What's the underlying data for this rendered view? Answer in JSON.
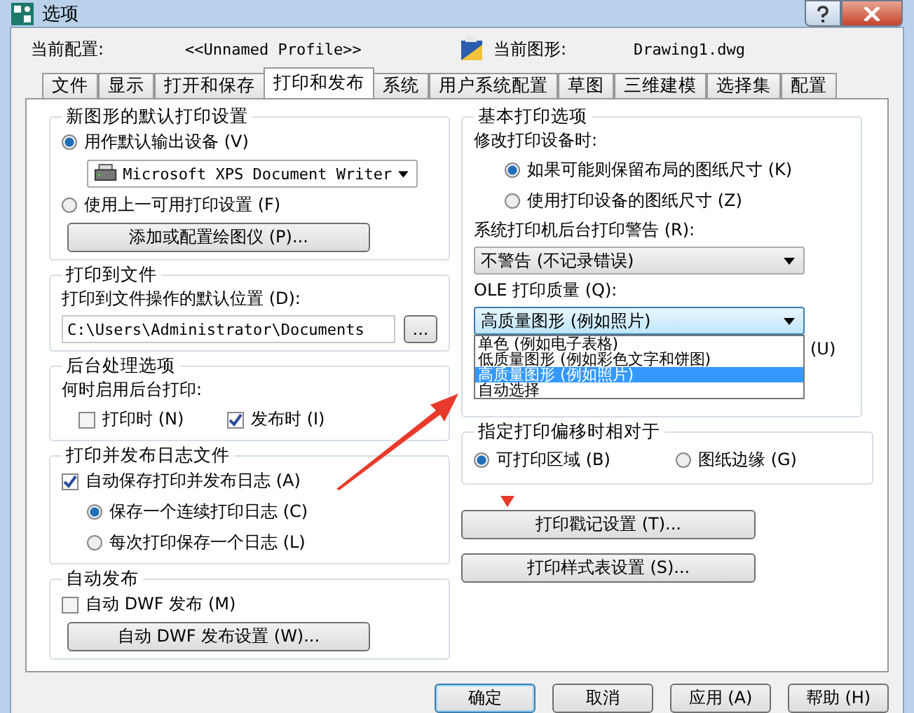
{
  "window": {
    "title": "选项"
  },
  "profile": {
    "label": "当前配置:",
    "value": "<<Unnamed Profile>>"
  },
  "drawing": {
    "label": "当前图形:",
    "value": "Drawing1.dwg"
  },
  "tabs": [
    {
      "label": "文件",
      "selected": false
    },
    {
      "label": "显示",
      "selected": false
    },
    {
      "label": "打开和保存",
      "selected": false
    },
    {
      "label": "打印和发布",
      "selected": true
    },
    {
      "label": "系统",
      "selected": false
    },
    {
      "label": "用户系统配置",
      "selected": false
    },
    {
      "label": "草图",
      "selected": false
    },
    {
      "label": "三维建模",
      "selected": false
    },
    {
      "label": "选择集",
      "selected": false
    },
    {
      "label": "配置",
      "selected": false
    }
  ],
  "new_drawing_defaults": {
    "title": "新图形的默认打印设置",
    "use_default": {
      "label": "用作默认输出设备 (V)",
      "selected": true
    },
    "device": "Microsoft XPS Document Writer",
    "use_last": {
      "label": "使用上一可用打印设置 (F)",
      "selected": false
    },
    "button": "添加或配置绘图仪 (P)..."
  },
  "plot_to_file": {
    "title": "打印到文件",
    "label": "打印到文件操作的默认位置 (D):",
    "path": "C:\\Users\\Administrator\\Documents",
    "browse": "..."
  },
  "background": {
    "title": "后台处理选项",
    "label": "何时启用后台打印:",
    "options": [
      {
        "label": "打印时 (N)",
        "checked": false
      },
      {
        "label": "发布时 (I)",
        "checked": true
      }
    ]
  },
  "log": {
    "title": "打印并发布日志文件",
    "autosave": {
      "label": "自动保存打印并发布日志 (A)",
      "checked": true
    },
    "modes": [
      {
        "label": "保存一个连续打印日志 (C)",
        "selected": true
      },
      {
        "label": "每次打印保存一个日志 (L)",
        "selected": false
      }
    ]
  },
  "auto_publish": {
    "title": "自动发布",
    "auto_dwf": {
      "label": "自动 DWF 发布 (M)",
      "checked": false
    },
    "button": "自动 DWF 发布设置 (W)..."
  },
  "general": {
    "title": "基本打印选项",
    "change_label": "修改打印设备时:",
    "paper": [
      {
        "label": "如果可能则保留布局的图纸尺寸 (K)",
        "selected": true
      },
      {
        "label": "使用打印设备的图纸尺寸 (Z)",
        "selected": false
      }
    ],
    "spool_label": "系统打印机后台打印警告 (R):",
    "spool_value": "不警告 (不记录错误)",
    "ole_label": "OLE 打印质量 (Q):",
    "ole_value": "高质量图形 (例如照片)",
    "ole_options": [
      {
        "label": "单色 (例如电子表格)",
        "selected": false
      },
      {
        "label": "低质量图形 (例如彩色文字和饼图)",
        "selected": false
      },
      {
        "label": "高质量图形 (例如照片)",
        "selected": true
      },
      {
        "label": "自动选择",
        "selected": false
      }
    ],
    "covered_tail": "(U)"
  },
  "offset": {
    "title": "指定打印偏移时相对于",
    "options": [
      {
        "label": "可打印区域 (B)",
        "selected": true
      },
      {
        "label": "图纸边缘 (G)",
        "selected": false
      }
    ]
  },
  "side_buttons": [
    "打印戳记设置 (T)...",
    "打印样式表设置 (S)..."
  ],
  "buttons": [
    "确定",
    "取消",
    "应用 (A)",
    "帮助 (H)"
  ]
}
